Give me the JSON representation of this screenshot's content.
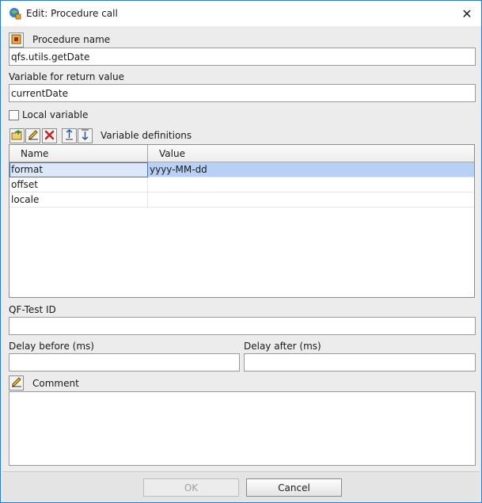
{
  "window": {
    "title": "Edit: Procedure call",
    "close_glyph": "✕",
    "accent": "#2b79d8"
  },
  "procedure": {
    "label": "Procedure name",
    "value": "qfs.utils.getDate"
  },
  "return_var": {
    "label": "Variable for return value",
    "value": "currentDate"
  },
  "local_var": {
    "label": "Local variable",
    "checked": false
  },
  "var_defs": {
    "label": "Variable definitions",
    "toolbar_icons": [
      "add-row-icon",
      "edit-row-icon",
      "delete-row-icon",
      "move-up-icon",
      "move-down-icon"
    ],
    "columns": [
      "Name",
      "Value"
    ],
    "rows": [
      {
        "name": "format",
        "value": "yyyy-MM-dd"
      },
      {
        "name": "offset",
        "value": ""
      },
      {
        "name": "locale",
        "value": ""
      }
    ],
    "selection_color": "#b8cff6"
  },
  "qftest_id": {
    "label": "QF-Test ID",
    "value": ""
  },
  "delay_before": {
    "label": "Delay before (ms)",
    "value": ""
  },
  "delay_after": {
    "label": "Delay after (ms)",
    "value": ""
  },
  "comment": {
    "label": "Comment",
    "value": ""
  },
  "buttons": {
    "ok": "OK",
    "cancel": "Cancel"
  }
}
